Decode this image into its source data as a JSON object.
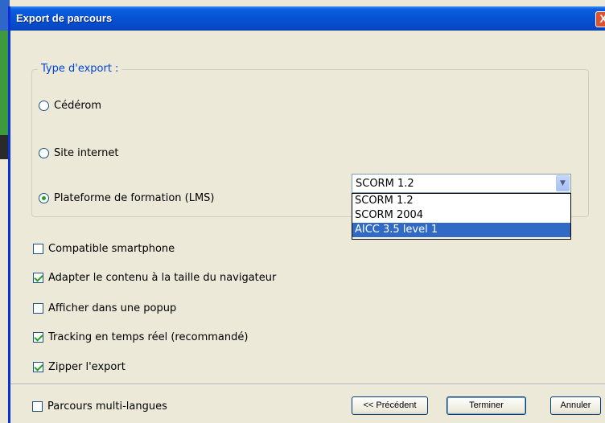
{
  "window": {
    "title": "Export de parcours",
    "close_label": "X"
  },
  "export_type": {
    "legend": "Type d'export :",
    "options": [
      {
        "label": "Cédérom",
        "checked": false
      },
      {
        "label": "Site internet",
        "checked": false
      },
      {
        "label": "Plateforme de formation (LMS)",
        "checked": true
      }
    ]
  },
  "lms_select": {
    "value": "SCORM 1.2",
    "options": [
      "SCORM 1.2",
      "SCORM 2004",
      "AICC 3.5 level 1"
    ],
    "highlighted": "AICC 3.5 level 1"
  },
  "checkboxes": [
    {
      "label": "Compatible smartphone",
      "checked": false
    },
    {
      "label": "Adapter le contenu à la taille du navigateur",
      "checked": true
    },
    {
      "label": "Afficher dans une popup",
      "checked": false
    },
    {
      "label": "Tracking en temps réel (recommandé)",
      "checked": true
    },
    {
      "label": "Zipper l'export",
      "checked": true
    }
  ],
  "footer": {
    "multilang_label": "Parcours multi-langues",
    "multilang_checked": false,
    "previous_label": "<< Précédent",
    "finish_label": "Terminer",
    "cancel_label": "Annuler"
  },
  "colors": {
    "titlebar": "#0652d4",
    "legend": "#0046d5",
    "check": "#21a121",
    "selection": "#316ac5"
  }
}
